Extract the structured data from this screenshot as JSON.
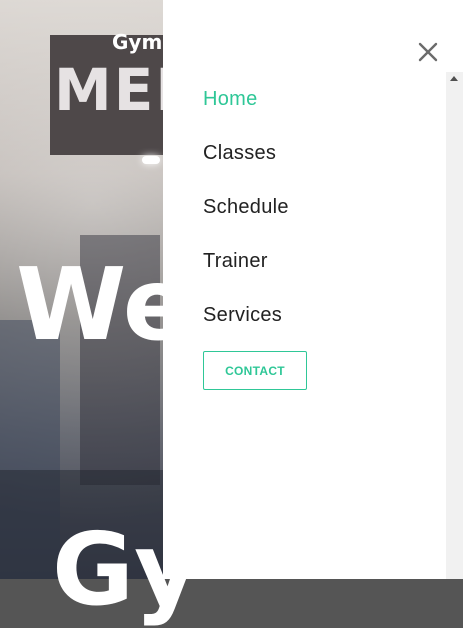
{
  "site": {
    "brand": "Gymo",
    "hero_title_line1": "We",
    "hero_title_line2": "Gy",
    "sign_text": "MEN"
  },
  "menu": {
    "items": [
      {
        "label": "Home",
        "active": true
      },
      {
        "label": "Classes",
        "active": false
      },
      {
        "label": "Schedule",
        "active": false
      },
      {
        "label": "Trainer",
        "active": false
      },
      {
        "label": "Services",
        "active": false
      }
    ],
    "contact_label": "CONTACT",
    "close_icon": "close-icon"
  },
  "colors": {
    "accent": "#2fc797",
    "text": "#222222",
    "drawer_bg": "#ffffff"
  }
}
